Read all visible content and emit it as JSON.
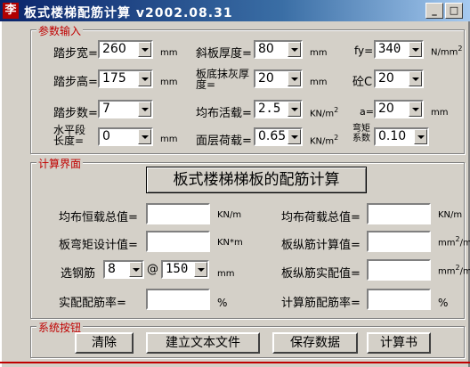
{
  "window": {
    "title": "板式楼梯配筋计算  v2002.08.31",
    "icon_symbol": "李",
    "controls": {
      "minimize": "_",
      "maximize": "□"
    }
  },
  "params": {
    "group_label": "参数输入",
    "step_width": {
      "label": "踏步宽=",
      "value": "260",
      "unit": "mm"
    },
    "step_height": {
      "label": "踏步高=",
      "value": "175",
      "unit": "mm"
    },
    "step_count": {
      "label": "踏步数=",
      "value": "7"
    },
    "horizontal_len": {
      "label": "水平段长度=",
      "value": "0",
      "unit": "mm"
    },
    "slab_thickness": {
      "label": "斜板厚度=",
      "value": "80",
      "unit": "mm"
    },
    "plaster_thickness": {
      "label": "板底抹灰厚度=",
      "value": "20",
      "unit": "mm"
    },
    "live_load": {
      "label": "均布活载=",
      "value": "2.5",
      "unit": "KN/m",
      "unit_sup": "2"
    },
    "surface_load": {
      "label": "面层荷载=",
      "value": "0.65",
      "unit": "KN/m",
      "unit_sup": "2"
    },
    "fy": {
      "label": "fy=",
      "value": "340",
      "unit": "N/mm",
      "unit_sup": "2"
    },
    "concrete": {
      "label": "砼C",
      "value": "20"
    },
    "a": {
      "label": "a=",
      "value": "20",
      "unit": "mm"
    },
    "moment_coef": {
      "label": "弯矩系数",
      "value": "0.10"
    }
  },
  "calc": {
    "group_label": "计算界面",
    "calc_button": "板式楼梯梯板的配筋计算",
    "dead_load_total": {
      "label": "均布恒载总值=",
      "unit": "KN/m",
      "value": ""
    },
    "load_total": {
      "label": "均布荷载总值=",
      "unit": "KN/m",
      "value": ""
    },
    "moment_design": {
      "label": "板弯矩设计值=",
      "unit": "KN*m",
      "value": ""
    },
    "long_rebar_calc": {
      "label": "板纵筋计算值=",
      "unit": "mm",
      "unit_sup": "2",
      "unit_tail": "/m",
      "value": ""
    },
    "select_rebar": {
      "label": "选钢筋",
      "diameter": "8",
      "at": "@",
      "spacing": "150",
      "unit": "mm"
    },
    "long_rebar_actual": {
      "label": "板纵筋实配值=",
      "unit": "mm",
      "unit_sup": "2",
      "unit_tail": "/m",
      "value": ""
    },
    "actual_ratio": {
      "label": "实配配筋率=",
      "unit": "%",
      "value": ""
    },
    "calc_ratio": {
      "label": "计算筋配筋率=",
      "unit": "%",
      "value": ""
    }
  },
  "system": {
    "group_label": "系统按钮",
    "clear": "清除",
    "make_text": "建立文本文件",
    "save": "保存数据",
    "calculator": "计算书"
  }
}
